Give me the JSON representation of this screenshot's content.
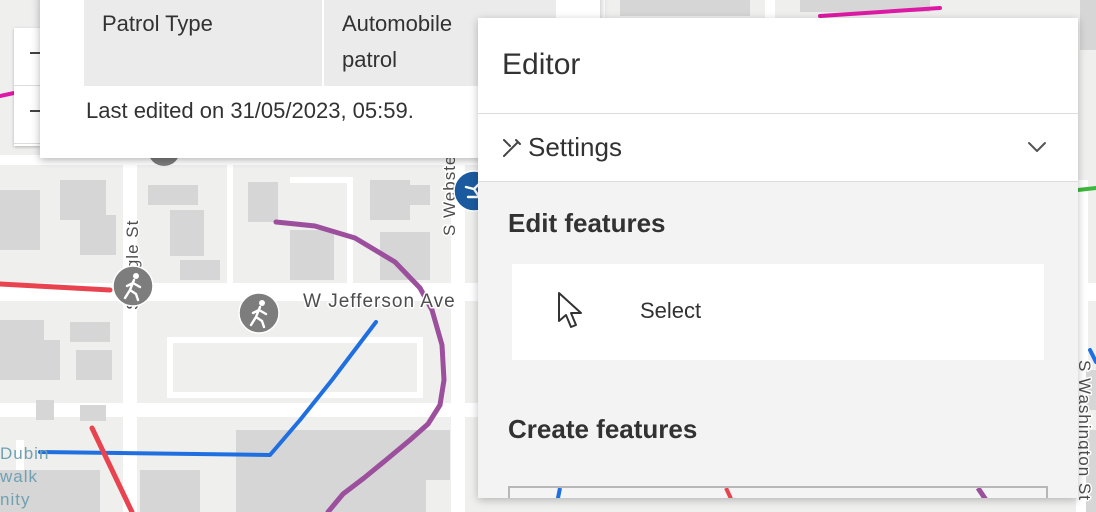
{
  "popup": {
    "field_label": "Patrol Type",
    "field_value_line1": "Automobile",
    "field_value_line2": "patrol",
    "last_edited": "Last edited on 31/05/2023, 05:59."
  },
  "editor": {
    "title": "Editor",
    "settings_label": "Settings",
    "settings_icon": "settings-icon",
    "edit_features_heading": "Edit features",
    "select_label": "Select",
    "select_icon": "cursor-arrow-icon",
    "create_features_heading": "Create features"
  },
  "map": {
    "street_labels": {
      "w_jefferson": "W Jefferson Ave",
      "s_eagle": "S Eagle St",
      "s_webster": "S Webster",
      "s_washington": "S Washington St"
    },
    "poi_label_line1": "Dubin",
    "poi_label_line2": "walk",
    "poi_label_line3": "nity",
    "icons": [
      "pedestrian-icon",
      "skater-icon"
    ],
    "colors": {
      "purple_route": "#9c4f9c",
      "blue_route": "#1f6fe0",
      "red_route": "#e8434f",
      "magenta_route": "#dd1aa5",
      "green_route": "#3cb83c",
      "building": "#d6d6d6",
      "road": "#ffffff",
      "background": "#efefee"
    }
  }
}
